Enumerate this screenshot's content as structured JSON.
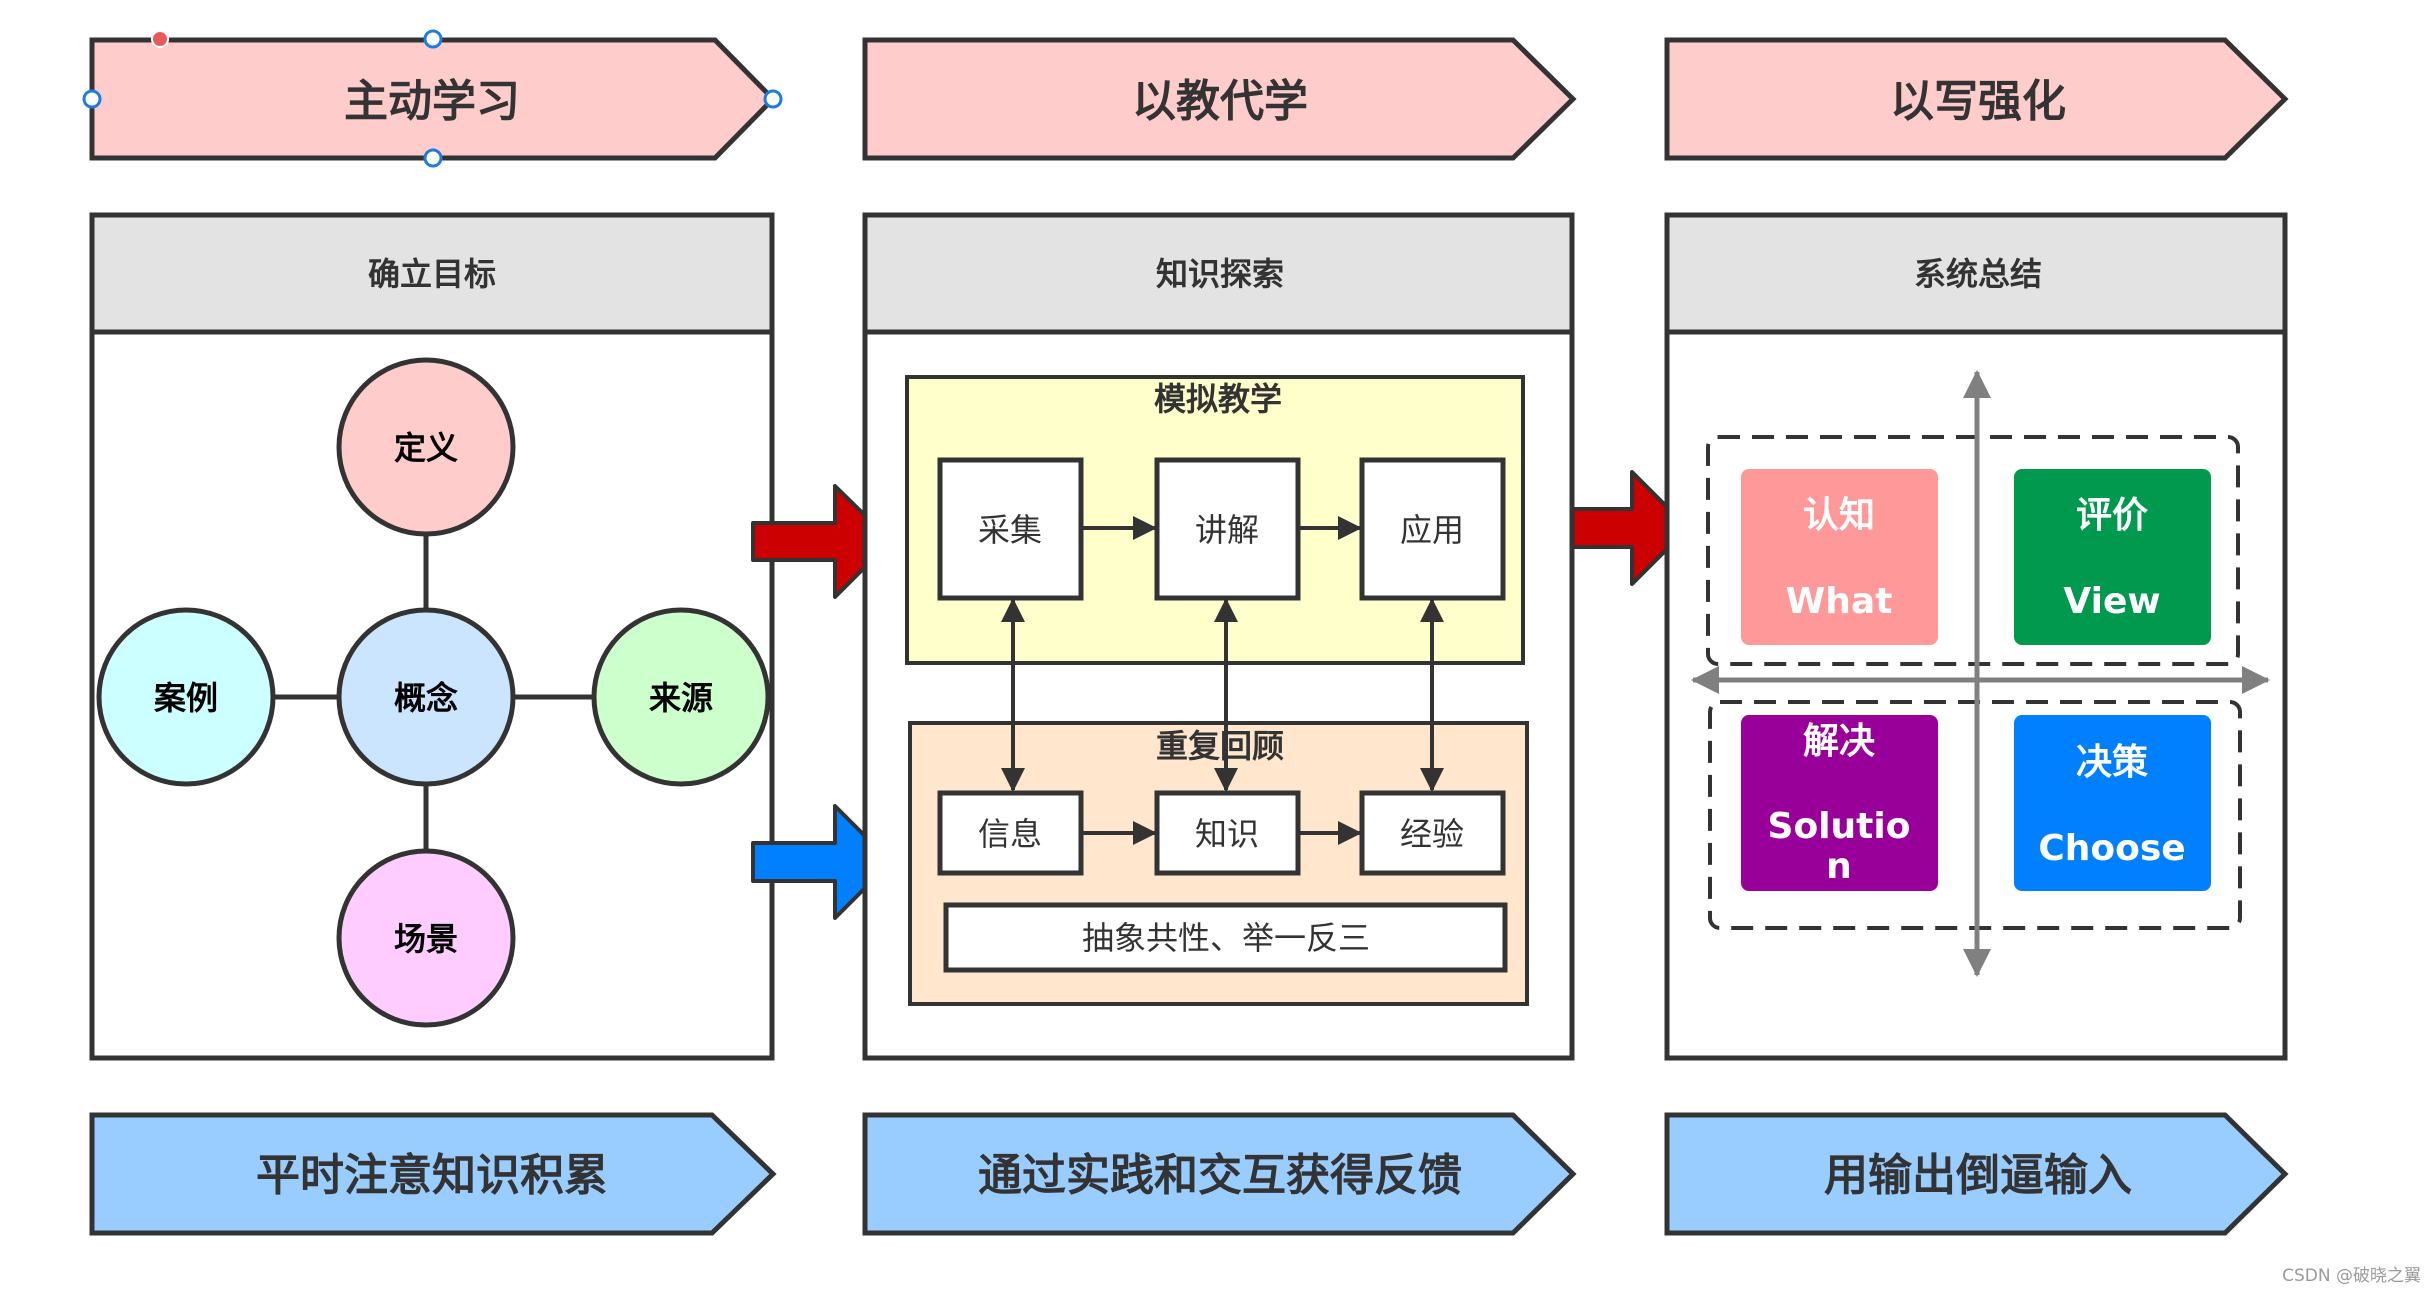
{
  "colors": {
    "stroke": "#333333",
    "banner_top_fill": "#FFCCCC",
    "banner_bottom_fill": "#99CCFF",
    "panel_header_fill": "#E3E3E3",
    "panel_body_fill": "#FFFFFF",
    "arrow_red": "#CC0000",
    "arrow_blue": "#007FFF",
    "group_yellow": "#FFFFCC",
    "group_peach": "#FFE6CC",
    "axis_gray": "#808080",
    "selection_handle": "#1E7BE0",
    "selection_red_dot": "#E85A5A"
  },
  "top_banners": [
    {
      "label": "主动学习"
    },
    {
      "label": "以教代学"
    },
    {
      "label": "以写强化"
    }
  ],
  "bottom_banners": [
    {
      "label": "平时注意知识积累"
    },
    {
      "label": "通过实践和交互获得反馈"
    },
    {
      "label": "用输出倒逼输入"
    }
  ],
  "panels": [
    {
      "title": "确立目标",
      "center_node": {
        "label": "概念",
        "fill": "#CCE5FF"
      },
      "nodes": [
        {
          "label": "定义",
          "position": "top",
          "fill": "#FFCCCC"
        },
        {
          "label": "案例",
          "position": "left",
          "fill": "#CCFFFF"
        },
        {
          "label": "来源",
          "position": "right",
          "fill": "#CCFFCC"
        },
        {
          "label": "场景",
          "position": "bottom",
          "fill": "#FFCCFF"
        }
      ]
    },
    {
      "title": "知识探索",
      "groups": [
        {
          "title": "模拟教学",
          "steps": [
            "采集",
            "讲解",
            "应用"
          ]
        },
        {
          "title": "重复回顾",
          "steps": [
            "信息",
            "知识",
            "经验"
          ],
          "footer": "抽象共性、举一反三"
        }
      ]
    },
    {
      "title": "系统总结",
      "quadrants": [
        {
          "title": "认知",
          "subtitle": "What",
          "fill": "#FF9999"
        },
        {
          "title": "评价",
          "subtitle": "View",
          "fill": "#00994D"
        },
        {
          "title": "解决",
          "subtitle_lines": [
            "Solutio",
            "n"
          ],
          "fill": "#990099"
        },
        {
          "title": "决策",
          "subtitle": "Choose",
          "fill": "#007FFF"
        }
      ]
    }
  ],
  "watermark": "CSDN @破晓之翼"
}
